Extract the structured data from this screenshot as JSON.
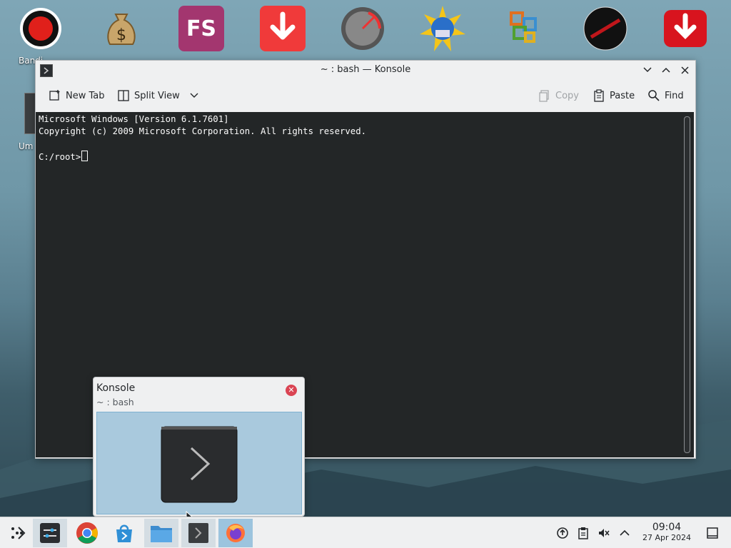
{
  "desktop": {
    "icons": [
      {
        "name": "bandicam-icon",
        "label": "Bandi"
      },
      {
        "name": "money-bag-icon",
        "label": ""
      },
      {
        "name": "fs-app-icon",
        "label": "",
        "text": "FS"
      },
      {
        "name": "downloader-icon",
        "label": ""
      },
      {
        "name": "gauge-icon",
        "label": ""
      },
      {
        "name": "globe-icon",
        "label": ""
      },
      {
        "name": "office-grid-icon",
        "label": ""
      },
      {
        "name": "red-slash-icon",
        "label": ""
      },
      {
        "name": "download-shield-icon",
        "label": ""
      }
    ],
    "side_label": "Um"
  },
  "konsole": {
    "title": "~ : bash — Konsole",
    "toolbar": {
      "new_tab": "New Tab",
      "split_view": "Split View",
      "copy": "Copy",
      "paste": "Paste",
      "find": "Find"
    },
    "terminal": {
      "line1": "Microsoft Windows [Version 6.1.7601]",
      "line2": "Copyright (c) 2009 Microsoft Corporation. All rights reserved.",
      "prompt": "C:/root>"
    }
  },
  "tooltip": {
    "title": "Konsole",
    "subtitle": "~ : bash"
  },
  "taskbar": {
    "apps": [
      "launcher-icon",
      "system-settings-icon",
      "chrome-icon",
      "discover-store-icon",
      "file-manager-icon",
      "konsole-icon",
      "firefox-icon"
    ],
    "clock": {
      "time": "09:04",
      "date": "27 Apr 2024"
    }
  },
  "colors": {
    "terminal_bg": "#232627",
    "accent": "#3daee9",
    "close_red": "#da4453"
  }
}
